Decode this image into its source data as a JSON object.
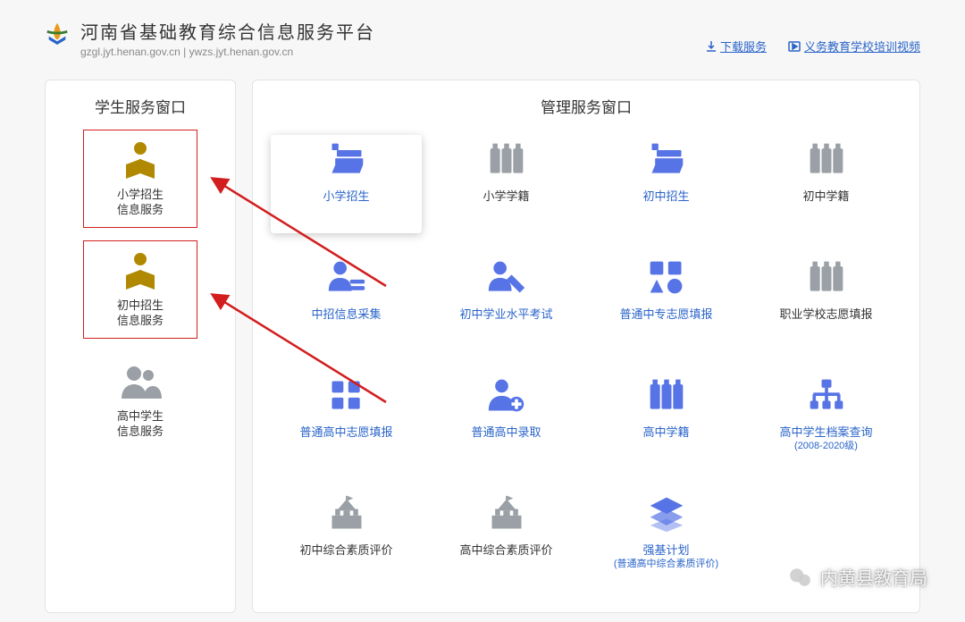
{
  "header": {
    "title": "河南省基础教育综合信息服务平台",
    "subtitle": "gzgl.jyt.henan.gov.cn | ywzs.jyt.henan.gov.cn",
    "links": {
      "download": "下载服务",
      "video": "义务教育学校培训视频"
    }
  },
  "student_panel": {
    "title": "学生服务窗口",
    "items": [
      {
        "line1": "小学招生",
        "line2": "信息服务",
        "icon": "person-book",
        "highlight": true
      },
      {
        "line1": "初中招生",
        "line2": "信息服务",
        "icon": "person-book",
        "highlight": true
      },
      {
        "line1": "高中学生",
        "line2": "信息服务",
        "icon": "people",
        "highlight": false
      }
    ]
  },
  "admin_panel": {
    "title": "管理服务窗口",
    "items": [
      {
        "label": "小学招生",
        "sub": "",
        "icon": "books",
        "color": "blue",
        "active_label": true,
        "selected": true
      },
      {
        "label": "小学学籍",
        "sub": "",
        "icon": "binders",
        "color": "gray",
        "active_label": false
      },
      {
        "label": "初中招生",
        "sub": "",
        "icon": "books",
        "color": "blue",
        "active_label": true
      },
      {
        "label": "初中学籍",
        "sub": "",
        "icon": "binders",
        "color": "gray",
        "active_label": false
      },
      {
        "label": "中招信息采集",
        "sub": "",
        "icon": "user-list",
        "color": "blue",
        "active_label": true
      },
      {
        "label": "初中学业水平考试",
        "sub": "",
        "icon": "user-edit",
        "color": "blue",
        "active_label": true
      },
      {
        "label": "普通中专志愿填报",
        "sub": "",
        "icon": "shapes",
        "color": "blue",
        "active_label": true
      },
      {
        "label": "职业学校志愿填报",
        "sub": "",
        "icon": "binders",
        "color": "gray",
        "active_label": false
      },
      {
        "label": "普通高中志愿填报",
        "sub": "",
        "icon": "grid4",
        "color": "blue",
        "active_label": true
      },
      {
        "label": "普通高中录取",
        "sub": "",
        "icon": "user-add",
        "color": "blue",
        "active_label": true
      },
      {
        "label": "高中学籍",
        "sub": "",
        "icon": "binders",
        "color": "blue",
        "active_label": true
      },
      {
        "label": "高中学生档案查询",
        "sub": "(2008-2020级)",
        "icon": "hierarchy",
        "color": "blue",
        "active_label": true
      },
      {
        "label": "初中综合素质评价",
        "sub": "",
        "icon": "school",
        "color": "gray",
        "active_label": false
      },
      {
        "label": "高中综合素质评价",
        "sub": "",
        "icon": "school",
        "color": "gray",
        "active_label": false
      },
      {
        "label": "强基计划",
        "sub": "(普通高中综合素质评价)",
        "icon": "layers",
        "color": "blue",
        "active_label": true
      }
    ]
  },
  "watermark": "内黄县教育局"
}
